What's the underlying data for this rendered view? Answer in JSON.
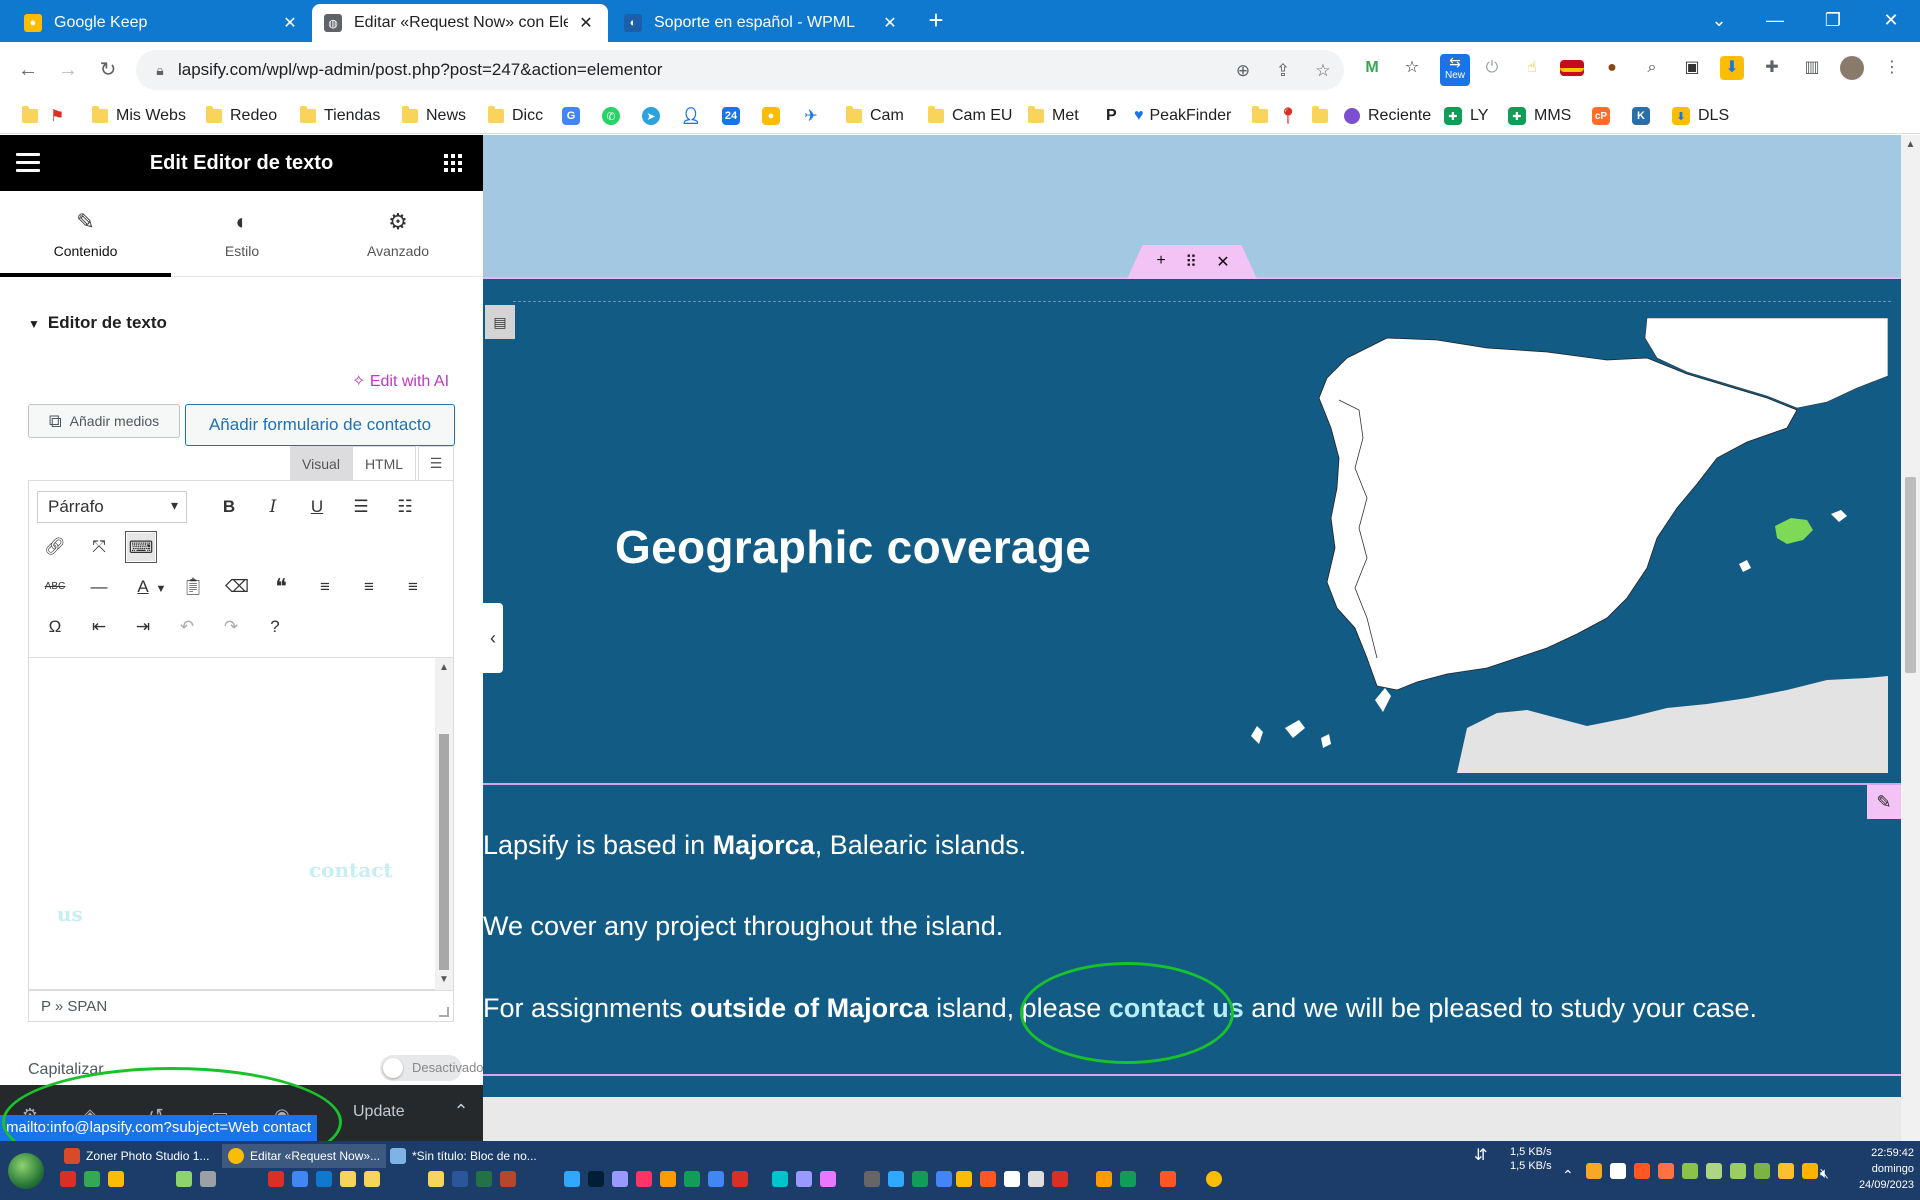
{
  "browser": {
    "tabs": [
      {
        "label": "Google Keep",
        "active": false,
        "icon_color": "#fbbc04"
      },
      {
        "label": "Editar «Request Now» con Eleme",
        "active": true,
        "icon_color": "#5f6368"
      },
      {
        "label": "Soporte en español - WPML",
        "active": false,
        "icon_color": "#1b5fa8"
      }
    ],
    "url": "lapsify.com/wpl/wp-admin/post.php?post=247&action=elementor",
    "extension_badge": "New"
  },
  "bookmarks": [
    {
      "label": "",
      "type": "folder"
    },
    {
      "label": "",
      "type": "flag"
    },
    {
      "label": "Mis Webs",
      "type": "folder"
    },
    {
      "label": "Redeo",
      "type": "folder"
    },
    {
      "label": "Tiendas",
      "type": "folder"
    },
    {
      "label": "News",
      "type": "folder"
    },
    {
      "label": "Dicc",
      "type": "folder"
    },
    {
      "label": "Cam",
      "type": "folder"
    },
    {
      "label": "Cam EU",
      "type": "folder"
    },
    {
      "label": "Met",
      "type": "folder"
    },
    {
      "label": "PeakFinder",
      "type": "heart"
    },
    {
      "label": "Reciente",
      "type": "circle"
    },
    {
      "label": "LY",
      "type": "plus"
    },
    {
      "label": "MMS",
      "type": "plus"
    },
    {
      "label": "DLS",
      "type": "arrow"
    }
  ],
  "panel": {
    "title": "Edit Editor de texto",
    "tabs": [
      "Contenido",
      "Estilo",
      "Avanzado"
    ],
    "section_title": "Editor de texto",
    "edit_with_ai": "Edit with AI",
    "add_media": "Añadir medios",
    "add_contact_form": "Añadir formulario de contacto",
    "editor_tabs": [
      "Visual",
      "HTML"
    ],
    "format_select": "Párrafo",
    "editor_ghost_text_1": "contact",
    "editor_ghost_text_2": "us",
    "status_path": "P » SPAN",
    "capitalize_label": "Capitalizar",
    "capitalize_toggle": "Desactivado",
    "update_label": "Update",
    "status_url": "mailto:info@lapsify.com?subject=Web contact"
  },
  "preview": {
    "heading": "Geographic coverage",
    "para1": {
      "text1": "Lapsify is based in ",
      "bold1": "Majorca",
      "text2": ", Balearic islands."
    },
    "para2": {
      "text1": "We cover any project throughout the island."
    },
    "para3": {
      "text1": "For assignments ",
      "bold1": "outside of Majorca",
      "text2": " island, please ",
      "link": "contact us",
      "text3": " and we will be pleased to study your case."
    },
    "colors": {
      "section_bg": "#125b85",
      "band_bg": "#a2c8e2",
      "link": "#b7eef3",
      "highlight_region": "#7ed957"
    }
  },
  "taskbar": {
    "items": [
      "Zoner Photo Studio 1...",
      "Editar «Request Now»...",
      "*Sin título: Bloc de no..."
    ],
    "speed_down": "1,5 KB/s",
    "speed_up": "1,5 KB/s",
    "time": "22:59:42",
    "day": "domingo",
    "date": "24/09/2023"
  }
}
